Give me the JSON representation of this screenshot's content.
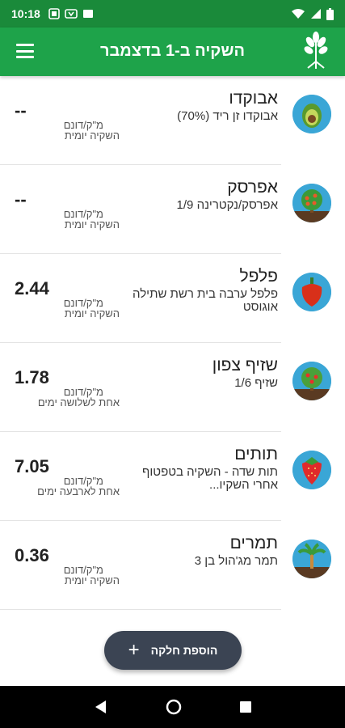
{
  "status": {
    "time": "10:18"
  },
  "header": {
    "title": "השקיה ב-1 בדצמבר"
  },
  "colors": {
    "primary": "#1ea34a",
    "status": "#1a8a3a",
    "fab": "#3b4453"
  },
  "crops": [
    {
      "name": "אבוקדו",
      "variety": "אבוקדו זן ריד (70%)",
      "value": "--",
      "unit": "מ\"ק/דונם",
      "frequency": "השקיה יומית",
      "icon": "avocado-icon"
    },
    {
      "name": "אפרסק",
      "variety": "אפרסק/נקטרינה 1/9",
      "value": "--",
      "unit": "מ\"ק/דונם",
      "frequency": "השקיה יומית",
      "icon": "peach-tree-icon"
    },
    {
      "name": "פלפל",
      "variety": "פלפל ערבה בית רשת שתילה אוגוסט",
      "value": "2.44",
      "unit": "מ\"ק/דונם",
      "frequency": "השקיה יומית",
      "icon": "pepper-icon"
    },
    {
      "name": "שזיף צפון",
      "variety": "שזיף 1/6",
      "value": "1.78",
      "unit": "מ\"ק/דונם",
      "frequency": "אחת לשלושה ימים",
      "icon": "plum-tree-icon"
    },
    {
      "name": "תותים",
      "variety": "תות שדה - השקיה בטפטוף אחרי השקיו...",
      "value": "7.05",
      "unit": "מ\"ק/דונם",
      "frequency": "אחת לארבעה ימים",
      "icon": "strawberry-icon"
    },
    {
      "name": "תמרים",
      "variety": "תמר מג'הול בן 3",
      "value": "0.36",
      "unit": "מ\"ק/דונם",
      "frequency": "השקיה יומית",
      "icon": "palm-tree-icon"
    }
  ],
  "fab": {
    "label": "הוספת חלקה"
  }
}
